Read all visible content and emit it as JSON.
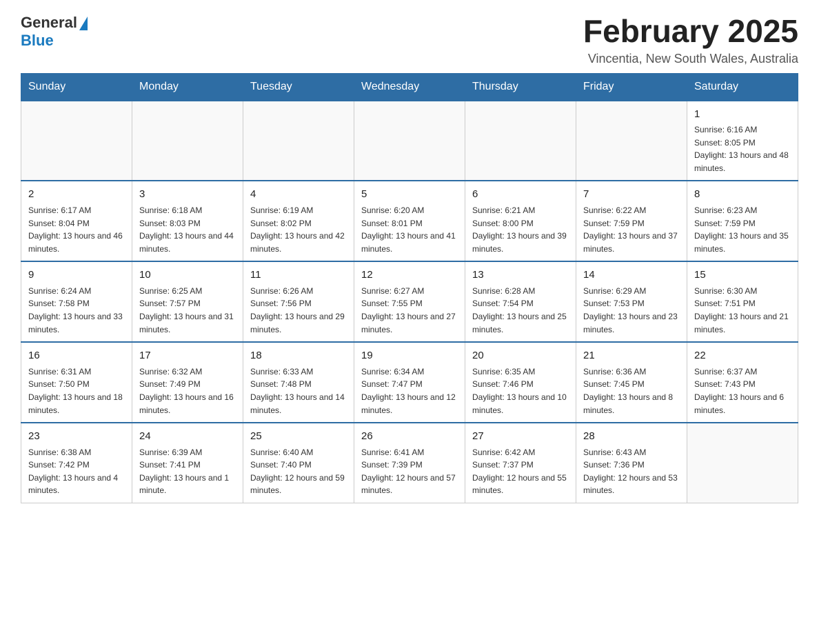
{
  "header": {
    "logo_general": "General",
    "logo_blue": "Blue",
    "month_title": "February 2025",
    "location": "Vincentia, New South Wales, Australia"
  },
  "days_of_week": [
    "Sunday",
    "Monday",
    "Tuesday",
    "Wednesday",
    "Thursday",
    "Friday",
    "Saturday"
  ],
  "weeks": [
    [
      {
        "day": "",
        "info": ""
      },
      {
        "day": "",
        "info": ""
      },
      {
        "day": "",
        "info": ""
      },
      {
        "day": "",
        "info": ""
      },
      {
        "day": "",
        "info": ""
      },
      {
        "day": "",
        "info": ""
      },
      {
        "day": "1",
        "info": "Sunrise: 6:16 AM\nSunset: 8:05 PM\nDaylight: 13 hours and 48 minutes."
      }
    ],
    [
      {
        "day": "2",
        "info": "Sunrise: 6:17 AM\nSunset: 8:04 PM\nDaylight: 13 hours and 46 minutes."
      },
      {
        "day": "3",
        "info": "Sunrise: 6:18 AM\nSunset: 8:03 PM\nDaylight: 13 hours and 44 minutes."
      },
      {
        "day": "4",
        "info": "Sunrise: 6:19 AM\nSunset: 8:02 PM\nDaylight: 13 hours and 42 minutes."
      },
      {
        "day": "5",
        "info": "Sunrise: 6:20 AM\nSunset: 8:01 PM\nDaylight: 13 hours and 41 minutes."
      },
      {
        "day": "6",
        "info": "Sunrise: 6:21 AM\nSunset: 8:00 PM\nDaylight: 13 hours and 39 minutes."
      },
      {
        "day": "7",
        "info": "Sunrise: 6:22 AM\nSunset: 7:59 PM\nDaylight: 13 hours and 37 minutes."
      },
      {
        "day": "8",
        "info": "Sunrise: 6:23 AM\nSunset: 7:59 PM\nDaylight: 13 hours and 35 minutes."
      }
    ],
    [
      {
        "day": "9",
        "info": "Sunrise: 6:24 AM\nSunset: 7:58 PM\nDaylight: 13 hours and 33 minutes."
      },
      {
        "day": "10",
        "info": "Sunrise: 6:25 AM\nSunset: 7:57 PM\nDaylight: 13 hours and 31 minutes."
      },
      {
        "day": "11",
        "info": "Sunrise: 6:26 AM\nSunset: 7:56 PM\nDaylight: 13 hours and 29 minutes."
      },
      {
        "day": "12",
        "info": "Sunrise: 6:27 AM\nSunset: 7:55 PM\nDaylight: 13 hours and 27 minutes."
      },
      {
        "day": "13",
        "info": "Sunrise: 6:28 AM\nSunset: 7:54 PM\nDaylight: 13 hours and 25 minutes."
      },
      {
        "day": "14",
        "info": "Sunrise: 6:29 AM\nSunset: 7:53 PM\nDaylight: 13 hours and 23 minutes."
      },
      {
        "day": "15",
        "info": "Sunrise: 6:30 AM\nSunset: 7:51 PM\nDaylight: 13 hours and 21 minutes."
      }
    ],
    [
      {
        "day": "16",
        "info": "Sunrise: 6:31 AM\nSunset: 7:50 PM\nDaylight: 13 hours and 18 minutes."
      },
      {
        "day": "17",
        "info": "Sunrise: 6:32 AM\nSunset: 7:49 PM\nDaylight: 13 hours and 16 minutes."
      },
      {
        "day": "18",
        "info": "Sunrise: 6:33 AM\nSunset: 7:48 PM\nDaylight: 13 hours and 14 minutes."
      },
      {
        "day": "19",
        "info": "Sunrise: 6:34 AM\nSunset: 7:47 PM\nDaylight: 13 hours and 12 minutes."
      },
      {
        "day": "20",
        "info": "Sunrise: 6:35 AM\nSunset: 7:46 PM\nDaylight: 13 hours and 10 minutes."
      },
      {
        "day": "21",
        "info": "Sunrise: 6:36 AM\nSunset: 7:45 PM\nDaylight: 13 hours and 8 minutes."
      },
      {
        "day": "22",
        "info": "Sunrise: 6:37 AM\nSunset: 7:43 PM\nDaylight: 13 hours and 6 minutes."
      }
    ],
    [
      {
        "day": "23",
        "info": "Sunrise: 6:38 AM\nSunset: 7:42 PM\nDaylight: 13 hours and 4 minutes."
      },
      {
        "day": "24",
        "info": "Sunrise: 6:39 AM\nSunset: 7:41 PM\nDaylight: 13 hours and 1 minute."
      },
      {
        "day": "25",
        "info": "Sunrise: 6:40 AM\nSunset: 7:40 PM\nDaylight: 12 hours and 59 minutes."
      },
      {
        "day": "26",
        "info": "Sunrise: 6:41 AM\nSunset: 7:39 PM\nDaylight: 12 hours and 57 minutes."
      },
      {
        "day": "27",
        "info": "Sunrise: 6:42 AM\nSunset: 7:37 PM\nDaylight: 12 hours and 55 minutes."
      },
      {
        "day": "28",
        "info": "Sunrise: 6:43 AM\nSunset: 7:36 PM\nDaylight: 12 hours and 53 minutes."
      },
      {
        "day": "",
        "info": ""
      }
    ]
  ]
}
